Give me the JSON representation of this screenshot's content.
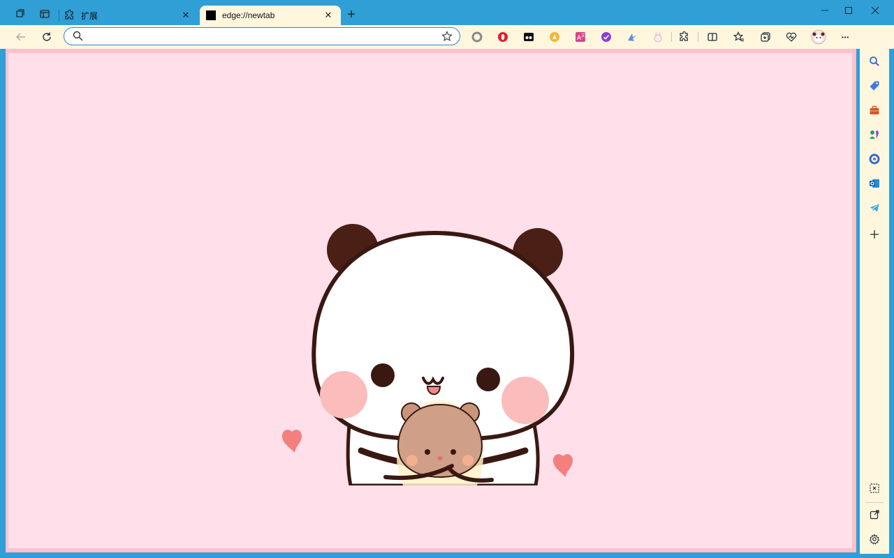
{
  "tabs": [
    {
      "label": "扩展",
      "icon": "puzzle-icon"
    },
    {
      "label": "edge://newtab",
      "icon": "black-square-icon"
    }
  ],
  "tab_close_symbol": "✕",
  "new_tab_symbol": "+",
  "window_controls": {
    "minimize": "—",
    "maximize": "☐",
    "close": "✕"
  },
  "toolbar": {
    "back_icon": "arrow-left-icon",
    "refresh_icon": "refresh-icon",
    "address_value": "",
    "address_placeholder": "",
    "more_symbol": "···"
  },
  "extensions": [
    "circle-extension-icon",
    "opera-extension-icon",
    "dual-dot-extension-icon",
    "yellow-compass-extension-icon",
    "translate-extension-icon",
    "purple-check-extension-icon",
    "bird-extension-icon",
    "bunny-extension-icon",
    "puzzle-extensions-icon",
    "split-screen-icon",
    "favorites-icon",
    "collections-icon",
    "browser-essentials-icon",
    "profile-avatar-icon"
  ],
  "sidebar": [
    "search-icon",
    "shopping-tag-icon",
    "tools-briefcase-icon",
    "games-icon",
    "microsoft-365-icon",
    "outlook-icon",
    "telegram-icon",
    "add-icon"
  ],
  "sidebar_bottom": [
    "screenshot-icon",
    "open-external-icon",
    "settings-icon"
  ],
  "colors": {
    "frame": "#2f9fd6",
    "toolbar": "#fff6de",
    "page_background": "#ffdfea",
    "page_border": "#ffc1cc"
  }
}
